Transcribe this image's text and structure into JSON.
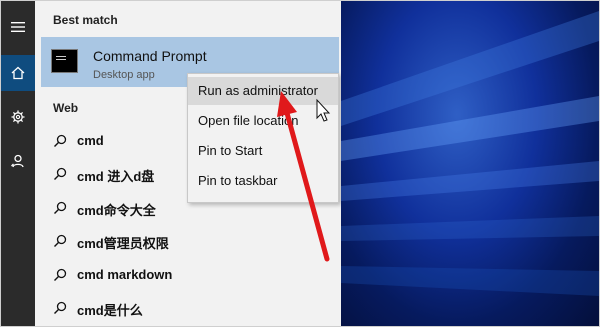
{
  "rail": {
    "items": [
      {
        "icon": "hamburger-menu-icon",
        "active": false
      },
      {
        "icon": "home-icon",
        "active": true
      },
      {
        "icon": "settings-gear-icon",
        "active": false
      },
      {
        "icon": "user-feedback-icon",
        "active": false
      }
    ]
  },
  "best_match": {
    "header": "Best match",
    "item": {
      "icon": "command-prompt-icon",
      "title": "Command Prompt",
      "subtitle": "Desktop app"
    }
  },
  "web": {
    "header": "Web",
    "results": [
      "cmd",
      "cmd 进入d盘",
      "cmd命令大全",
      "cmd管理员权限",
      "cmd markdown",
      "cmd是什么"
    ]
  },
  "context_menu": {
    "items": [
      "Run as administrator",
      "Open file location",
      "Pin to Start",
      "Pin to taskbar"
    ],
    "hover_index": 0
  },
  "colors": {
    "accent": "#0f4c7f",
    "selection": "#a9c6e3",
    "arrow": "#e0191b",
    "desktop_glow": "#2f5fc5"
  }
}
